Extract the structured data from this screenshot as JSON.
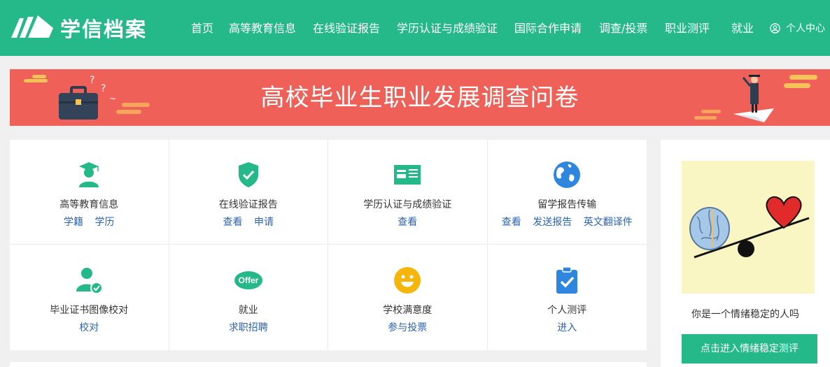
{
  "header": {
    "logo_text": "学信档案",
    "nav": [
      "首页",
      "高等教育信息",
      "在线验证报告",
      "学历认证与成绩验证",
      "国际合作申请",
      "调查/投票",
      "职业测评",
      "就业"
    ],
    "user_center": "个人中心"
  },
  "banner": {
    "title": "高校毕业生职业发展调查问卷"
  },
  "services": [
    {
      "title": "高等教育信息",
      "icon": "graduate-icon",
      "links": [
        "学籍",
        "学历"
      ]
    },
    {
      "title": "在线验证报告",
      "icon": "shield-check-icon",
      "links": [
        "查看",
        "申请"
      ]
    },
    {
      "title": "学历认证与成绩验证",
      "icon": "id-card-icon",
      "links": [
        "查看"
      ]
    },
    {
      "title": "留学报告传输",
      "icon": "globe-icon",
      "links": [
        "查看",
        "发送报告",
        "英文翻译件"
      ]
    },
    {
      "title": "毕业证书图像校对",
      "icon": "user-check-icon",
      "links": [
        "校对"
      ]
    },
    {
      "title": "就业",
      "icon": "offer-icon",
      "offer_label": "Offer",
      "links": [
        "求职招聘"
      ]
    },
    {
      "title": "学校满意度",
      "icon": "smile-icon",
      "links": [
        "参与投票"
      ]
    },
    {
      "title": "个人测评",
      "icon": "clipboard-check-icon",
      "links": [
        "进入"
      ]
    }
  ],
  "side_card": {
    "text": "你是一个情绪稳定的人吗",
    "button": "点击进入情绪稳定测评"
  },
  "colors": {
    "brand": "#25b888",
    "banner": "#ef6158",
    "link": "#2b63b5"
  }
}
